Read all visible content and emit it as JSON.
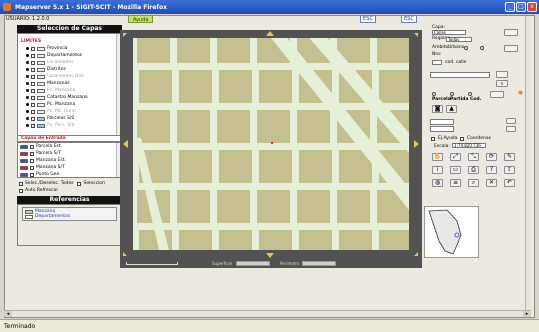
{
  "window": {
    "title": "Mapserver 5.x 1 - SIGIT-SCIT - Mozilla Firefox",
    "minimize": "_",
    "maximize": "□",
    "close": "x"
  },
  "toolbar": {
    "user_label": "USUARIO: 1.2.0.0",
    "ayuda_label": "Ayuda",
    "key_buttons": [
      "ESC",
      "ESC"
    ]
  },
  "left_panel": {
    "layers_header": "Seleccion de Capas",
    "layers_group_label": "LIMITES",
    "layers": [
      {
        "label": "Provincia",
        "style": "normal",
        "swatch": "#f0f0f0"
      },
      {
        "label": "Departamentos",
        "style": "normal",
        "swatch": "#f0f0f0"
      },
      {
        "label": "Localidades",
        "style": "gray",
        "swatch": "#f0f0f0"
      },
      {
        "label": "Distritos",
        "style": "normal",
        "swatch": "#f0f0f0"
      },
      {
        "label": "Localidades Dist.",
        "style": "gray",
        "swatch": "#f0f0f0"
      },
      {
        "label": "Manzanas",
        "style": "normal",
        "swatch": "#e8f0dc"
      },
      {
        "label": "Pc. Manzana",
        "style": "gray",
        "swatch": "#f0f0f0"
      },
      {
        "label": "Catastro Manzana",
        "style": "normal",
        "swatch": "#f0f0f0"
      },
      {
        "label": "Pc. Manzana",
        "style": "normal",
        "swatch": "#f0f0f0"
      },
      {
        "label": "Pc. Mz. Rural",
        "style": "gray",
        "swatch": "#f0f0f0"
      },
      {
        "label": "Parcelas S/S",
        "style": "normal",
        "swatch": "#9fc8ef"
      },
      {
        "label": "Pc. Parc. S/S",
        "style": "gray",
        "swatch": "#9fc8ef"
      }
    ],
    "extra_group_label": "Capas de Entrada",
    "extra_layers": [
      {
        "label": "Parcela Est.",
        "swatch": "#3050c8"
      },
      {
        "label": "Parcela S/T",
        "swatch": "#d82020"
      },
      {
        "label": "Manzana Est.",
        "swatch": "#3050c8"
      },
      {
        "label": "Manzana S/T",
        "swatch": "#d82020"
      },
      {
        "label": "Punto Gen.",
        "swatch": "#3050c8"
      }
    ],
    "select_all_label": "Selec./Deselec. Todas",
    "apply_label": "Seleccion",
    "auto_refresh_label": "Auto Refrescar",
    "references_header": "Referencias",
    "references": [
      {
        "label": "Manzana",
        "swatch": "#c4d79f"
      },
      {
        "label": "Departamentos",
        "swatch": "#ffffff"
      }
    ]
  },
  "map": {
    "footer_left_label": "Superficie",
    "footer_right_label": "Perimetro"
  },
  "right_panel": {
    "capa_label": "Capa:",
    "capa_value": "Calles",
    "region_label": "Region:",
    "region_value": "Todas",
    "ambito_label": "Ambito:",
    "ambito_value": "Urbano",
    "ambito_code": "cod. calle",
    "nro_label": "Nro:",
    "coord_label": "Coords",
    "radio_labels": [
      "Parcela",
      "Partida",
      "Cod."
    ],
    "overlap_label": "Ej.Ayuda",
    "overlap_value": "Coordenas",
    "escala_label": "Escala:",
    "escala_value": "1:74.820.736",
    "arrow_glyph": "→",
    "search_glyph": "⌕",
    "tool_glyphs": [
      "✋",
      "✎",
      "⤢",
      "⟳"
    ]
  },
  "status": {
    "text": "Terminado"
  }
}
